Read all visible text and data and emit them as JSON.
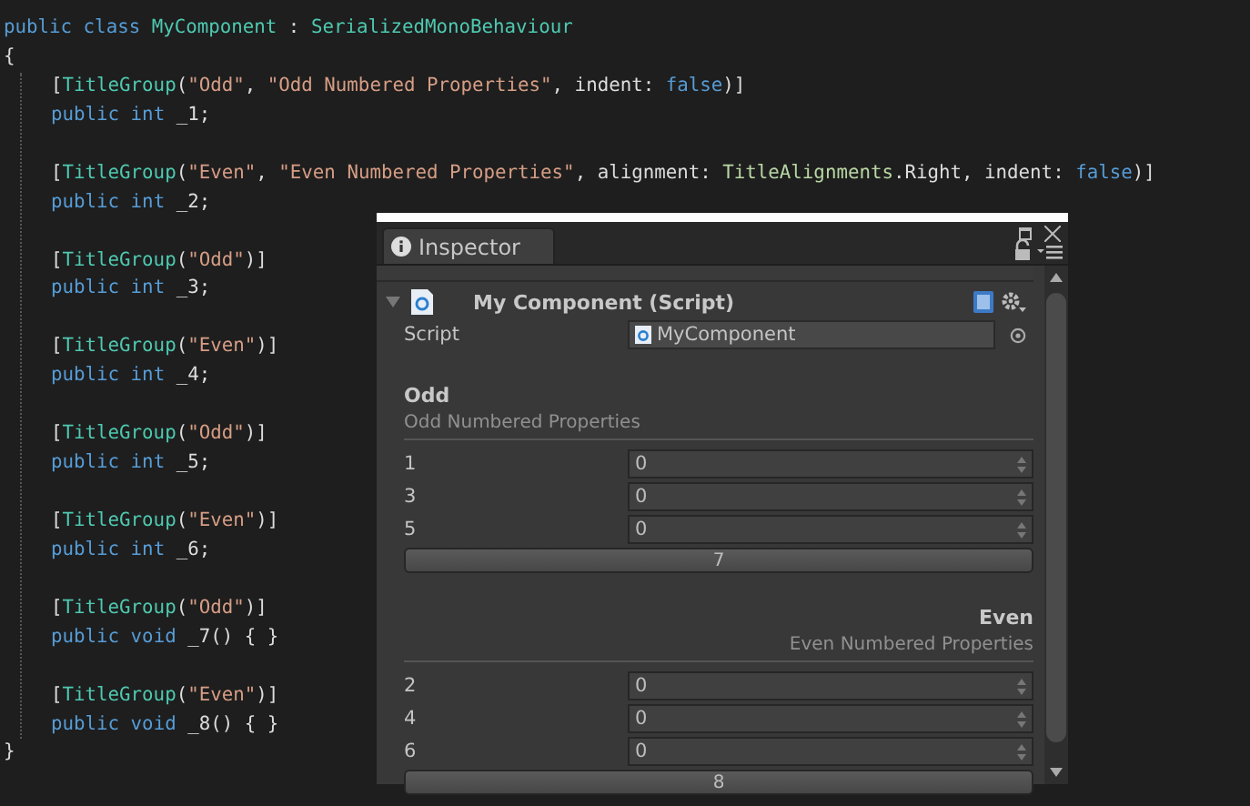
{
  "code": {
    "header": [
      [
        {
          "kind": "kw",
          "text": "public"
        },
        {
          "kind": "kw",
          "text": " class"
        },
        {
          "kind": "type",
          "text": " MyComponent"
        },
        {
          "kind": "plain",
          "text": " : "
        },
        {
          "kind": "type",
          "text": "SerializedMonoBehaviour"
        }
      ],
      [
        {
          "kind": "plain",
          "text": "{"
        }
      ]
    ],
    "members": [
      [
        [
          {
            "kind": "plain",
            "text": "["
          },
          {
            "kind": "type",
            "text": "TitleGroup"
          },
          {
            "kind": "plain",
            "text": "("
          },
          {
            "kind": "str",
            "text": "\"Odd\""
          },
          {
            "kind": "plain",
            "text": ", "
          },
          {
            "kind": "str",
            "text": "\"Odd Numbered Properties\""
          },
          {
            "kind": "plain",
            "text": ", indent: "
          },
          {
            "kind": "kw",
            "text": "false"
          },
          {
            "kind": "plain",
            "text": ")]"
          }
        ],
        [
          {
            "kind": "kw",
            "text": "public"
          },
          {
            "kind": "kw",
            "text": " int"
          },
          {
            "kind": "plain",
            "text": " _1;"
          }
        ]
      ],
      [
        [
          {
            "kind": "plain",
            "text": "["
          },
          {
            "kind": "type",
            "text": "TitleGroup"
          },
          {
            "kind": "plain",
            "text": "("
          },
          {
            "kind": "str",
            "text": "\"Even\""
          },
          {
            "kind": "plain",
            "text": ", "
          },
          {
            "kind": "str",
            "text": "\"Even Numbered Properties\""
          },
          {
            "kind": "plain",
            "text": ", alignment: "
          },
          {
            "kind": "enum",
            "text": "TitleAlignments"
          },
          {
            "kind": "plain",
            "text": ".Right, indent: "
          },
          {
            "kind": "kw",
            "text": "false"
          },
          {
            "kind": "plain",
            "text": ")]"
          }
        ],
        [
          {
            "kind": "kw",
            "text": "public"
          },
          {
            "kind": "kw",
            "text": " int"
          },
          {
            "kind": "plain",
            "text": " _2;"
          }
        ]
      ],
      [
        [
          {
            "kind": "plain",
            "text": "["
          },
          {
            "kind": "type",
            "text": "TitleGroup"
          },
          {
            "kind": "plain",
            "text": "("
          },
          {
            "kind": "str",
            "text": "\"Odd\""
          },
          {
            "kind": "plain",
            "text": ")]"
          }
        ],
        [
          {
            "kind": "kw",
            "text": "public"
          },
          {
            "kind": "kw",
            "text": " int"
          },
          {
            "kind": "plain",
            "text": " _3;"
          }
        ]
      ],
      [
        [
          {
            "kind": "plain",
            "text": "["
          },
          {
            "kind": "type",
            "text": "TitleGroup"
          },
          {
            "kind": "plain",
            "text": "("
          },
          {
            "kind": "str",
            "text": "\"Even\""
          },
          {
            "kind": "plain",
            "text": ")]"
          }
        ],
        [
          {
            "kind": "kw",
            "text": "public"
          },
          {
            "kind": "kw",
            "text": " int"
          },
          {
            "kind": "plain",
            "text": " _4;"
          }
        ]
      ],
      [
        [
          {
            "kind": "plain",
            "text": "["
          },
          {
            "kind": "type",
            "text": "TitleGroup"
          },
          {
            "kind": "plain",
            "text": "("
          },
          {
            "kind": "str",
            "text": "\"Odd\""
          },
          {
            "kind": "plain",
            "text": ")]"
          }
        ],
        [
          {
            "kind": "kw",
            "text": "public"
          },
          {
            "kind": "kw",
            "text": " int"
          },
          {
            "kind": "plain",
            "text": " _5;"
          }
        ]
      ],
      [
        [
          {
            "kind": "plain",
            "text": "["
          },
          {
            "kind": "type",
            "text": "TitleGroup"
          },
          {
            "kind": "plain",
            "text": "("
          },
          {
            "kind": "str",
            "text": "\"Even\""
          },
          {
            "kind": "plain",
            "text": ")]"
          }
        ],
        [
          {
            "kind": "kw",
            "text": "public"
          },
          {
            "kind": "kw",
            "text": " int"
          },
          {
            "kind": "plain",
            "text": " _6;"
          }
        ]
      ],
      [
        [
          {
            "kind": "plain",
            "text": "["
          },
          {
            "kind": "type",
            "text": "TitleGroup"
          },
          {
            "kind": "plain",
            "text": "("
          },
          {
            "kind": "str",
            "text": "\"Odd\""
          },
          {
            "kind": "plain",
            "text": ")]"
          }
        ],
        [
          {
            "kind": "kw",
            "text": "public"
          },
          {
            "kind": "kw",
            "text": " void"
          },
          {
            "kind": "plain",
            "text": " _7() { }"
          }
        ]
      ],
      [
        [
          {
            "kind": "plain",
            "text": "["
          },
          {
            "kind": "type",
            "text": "TitleGroup"
          },
          {
            "kind": "plain",
            "text": "("
          },
          {
            "kind": "str",
            "text": "\"Even\""
          },
          {
            "kind": "plain",
            "text": ")]"
          }
        ],
        [
          {
            "kind": "kw",
            "text": "public"
          },
          {
            "kind": "kw",
            "text": " void"
          },
          {
            "kind": "plain",
            "text": " _8() { }"
          }
        ]
      ]
    ],
    "footer": [
      [
        {
          "kind": "plain",
          "text": "}"
        }
      ]
    ]
  },
  "inspector": {
    "tab": {
      "label": "Inspector",
      "selected": true
    },
    "component": {
      "title": "My Component (Script)",
      "expanded": true
    },
    "script_field": {
      "label": "Script",
      "value": "MyComponent"
    },
    "groups": [
      {
        "kind": "left",
        "title": "Odd",
        "subtitle": "Odd Numbered Properties",
        "fields": [
          {
            "label": "1",
            "value": "0"
          },
          {
            "label": "3",
            "value": "0"
          },
          {
            "label": "5",
            "value": "0"
          }
        ],
        "button": "7"
      },
      {
        "kind": "right",
        "title": "Even",
        "subtitle": "Even Numbered Properties",
        "fields": [
          {
            "label": "2",
            "value": "0"
          },
          {
            "label": "4",
            "value": "0"
          },
          {
            "label": "6",
            "value": "0"
          }
        ],
        "button": "8"
      }
    ]
  }
}
